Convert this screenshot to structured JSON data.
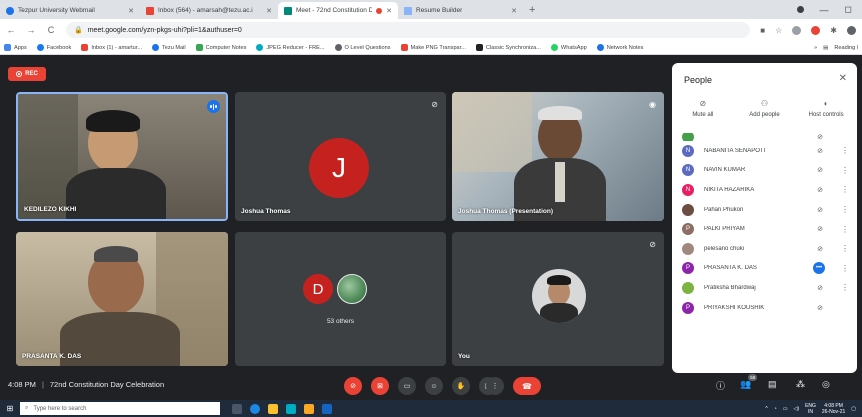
{
  "browser": {
    "tabs": [
      {
        "title": "Tezpur University Webmail",
        "color": "#1a73e8"
      },
      {
        "title": "Inbox (564) - amarsah@tezu.ac.i",
        "color": "#ea4335"
      },
      {
        "title": "Meet - 72nd Constitution Da",
        "color": "#00897b"
      },
      {
        "title": "Resume Builder",
        "color": "#8ab4f8"
      }
    ],
    "url": "meet.google.com/yzn-pkgs-uhi?pli=1&authuser=0",
    "bookmarks": [
      {
        "label": "Apps",
        "color": "#4285f4"
      },
      {
        "label": "Facebook",
        "color": "#1877f2"
      },
      {
        "label": "Inbox (1) - amartur...",
        "color": "#ea4335"
      },
      {
        "label": "Tezu Mail",
        "color": "#1a73e8"
      },
      {
        "label": "Computer Notes",
        "color": "#34a853"
      },
      {
        "label": "JPEG Reducer - FRE...",
        "color": "#00acc1"
      },
      {
        "label": "O Level Questions",
        "color": "#5f6368"
      },
      {
        "label": "Make PNG Transpar...",
        "color": "#ea4335"
      },
      {
        "label": "Classic Synchroniza...",
        "color": "#202124"
      },
      {
        "label": "WhatsApp",
        "color": "#25d366"
      },
      {
        "label": "Network Notes",
        "color": "#1a73e8"
      }
    ],
    "reading_list": "Reading l"
  },
  "meet": {
    "rec_label": "REC",
    "tiles": [
      {
        "name": "KEDILEZO KIKHI"
      },
      {
        "name": "Joshua Thomas",
        "initial": "J"
      },
      {
        "name": "Joshua Thomas (Presentation)"
      },
      {
        "name": "PRASANTA K. DAS"
      },
      {
        "initial": "D",
        "others_label": "53 others"
      },
      {
        "name": "You"
      }
    ],
    "people_panel": {
      "title": "People",
      "controls": [
        "Mute all",
        "Add people",
        "Host controls"
      ],
      "participants": [
        {
          "name": "NABANITA SENAPOTI",
          "initial": "N",
          "color": "#5c6bc0"
        },
        {
          "name": "NAVIN KUMAR",
          "initial": "N",
          "color": "#5c6bc0"
        },
        {
          "name": "NIKITA HAZARIKA",
          "initial": "N",
          "color": "#e91e63"
        },
        {
          "name": "Pahari Phukon",
          "initial": "",
          "color": "#6d4c41"
        },
        {
          "name": "PALKI PRIYAM",
          "initial": "P",
          "color": "#8d6e63"
        },
        {
          "name": "pelesano chuki",
          "initial": "",
          "color": "#a1887f"
        },
        {
          "name": "PRASANTA K. DAS",
          "initial": "P",
          "color": "#8e24aa"
        },
        {
          "name": "Pratiksha Bhardwaj",
          "initial": "",
          "color": "#7cb342"
        },
        {
          "name": "PRIYAKSHI KOUSHIK",
          "initial": "P",
          "color": "#8e24aa"
        }
      ]
    },
    "bottom": {
      "time": "4:08 PM",
      "meeting_title": "72nd Constitution Day Celebration",
      "participant_count": "58"
    }
  },
  "taskbar": {
    "search_placeholder": "Type here to search",
    "lang": "ENG",
    "region": "IN",
    "time": "4:08 PM",
    "date": "26-Nov-21"
  }
}
